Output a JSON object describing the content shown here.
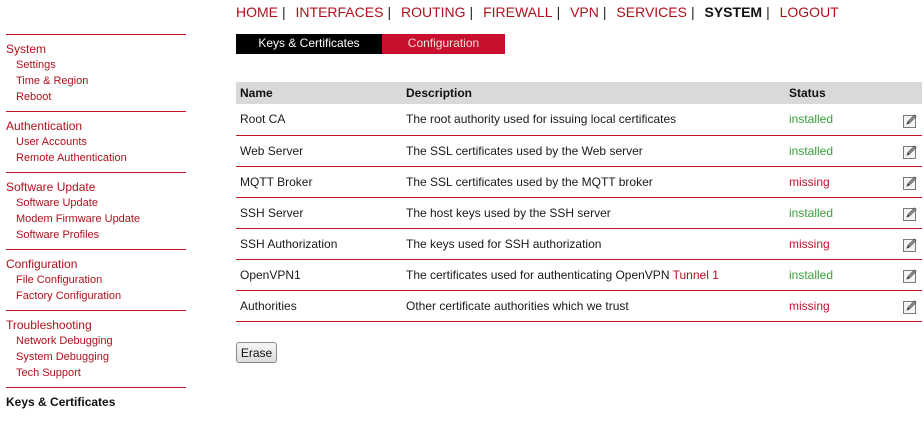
{
  "topnav": {
    "items": [
      "HOME",
      "INTERFACES",
      "ROUTING",
      "FIREWALL",
      "VPN",
      "SERVICES",
      "SYSTEM",
      "LOGOUT"
    ],
    "active": "SYSTEM"
  },
  "tabs": {
    "keys_label": "Keys & Certificates",
    "config_label": "Configuration"
  },
  "sidebar": {
    "system": {
      "title": "System",
      "items": [
        "Settings",
        "Time & Region",
        "Reboot"
      ]
    },
    "authentication": {
      "title": "Authentication",
      "items": [
        "User Accounts",
        "Remote Authentication"
      ]
    },
    "software_update": {
      "title": "Software Update",
      "items": [
        "Software Update",
        "Modem Firmware Update",
        "Software Profiles"
      ]
    },
    "configuration": {
      "title": "Configuration",
      "items": [
        "File Configuration",
        "Factory Configuration"
      ]
    },
    "troubleshooting": {
      "title": "Troubleshooting",
      "items": [
        "Network Debugging",
        "System Debugging",
        "Tech Support"
      ]
    },
    "current": "Keys & Certificates"
  },
  "table": {
    "headers": {
      "name": "Name",
      "description": "Description",
      "status": "Status"
    },
    "rows": [
      {
        "name": "Root CA",
        "description": "The root authority used for issuing local certificates",
        "description_link": "",
        "status": "installed"
      },
      {
        "name": "Web Server",
        "description": "The SSL certificates used by the Web server",
        "description_link": "",
        "status": "installed"
      },
      {
        "name": "MQTT Broker",
        "description": "The SSL certificates used by the MQTT broker",
        "description_link": "",
        "status": "missing"
      },
      {
        "name": "SSH Server",
        "description": "The host keys used by the SSH server",
        "description_link": "",
        "status": "installed"
      },
      {
        "name": "SSH Authorization",
        "description": "The keys used for SSH authorization",
        "description_link": "",
        "status": "missing"
      },
      {
        "name": "OpenVPN1",
        "description": "The certificates used for authenticating OpenVPN ",
        "description_link": "Tunnel 1",
        "status": "installed"
      },
      {
        "name": "Authorities",
        "description": "Other certificate authorities which we trust",
        "description_link": "",
        "status": "missing"
      }
    ],
    "row_action_icon": "edit-icon"
  },
  "actions": {
    "erase_label": "Erase"
  },
  "colors": {
    "accent": "#c8102e",
    "installed": "#3aa23a",
    "missing": "#c8102e",
    "header_bg": "#d9d9d9"
  }
}
